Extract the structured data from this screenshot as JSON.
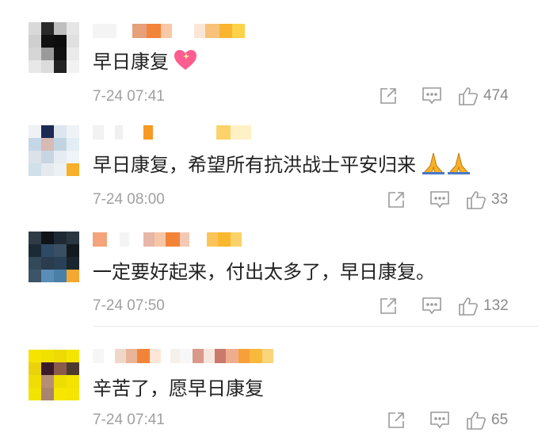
{
  "comments": [
    {
      "text": "早日康复",
      "time": "7-24 07:41",
      "likes": "474",
      "emoji": "heart-emoji"
    },
    {
      "text": "早日康复，希望所有抗洪战士平安归来",
      "time": "7-24 08:00",
      "likes": "33",
      "emoji": "pray-emoji"
    },
    {
      "text": "一定要好起来，付出太多了，早日康复。",
      "time": "7-24 07:50",
      "likes": "132",
      "emoji": ""
    },
    {
      "text": "辛苦了，愿早日康复",
      "time": "7-24 07:41",
      "likes": "65",
      "emoji": ""
    }
  ],
  "icons": {
    "share": "share-icon",
    "reply": "comment-icon",
    "like": "thumbs-up-icon"
  },
  "colors": {
    "text": "#222222",
    "meta": "#a0a0a0",
    "icon": "#9a9a9a",
    "blur_orange": "#f79a23"
  }
}
